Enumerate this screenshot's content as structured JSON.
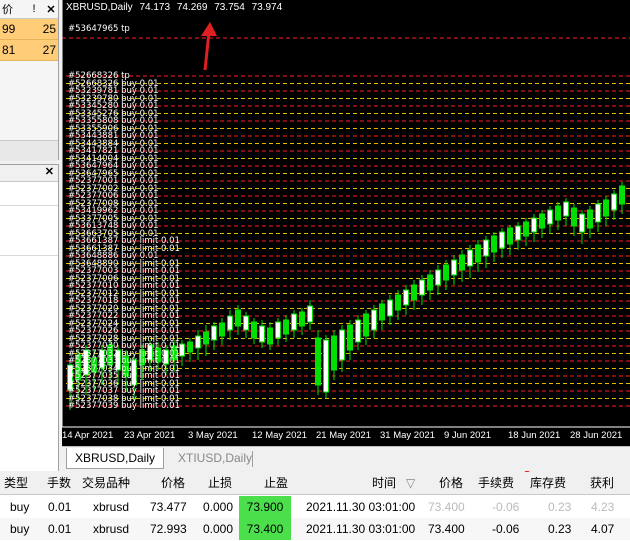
{
  "left_panel": {
    "header": {
      "col1": "价",
      "col2": "!",
      "close_icon": "close-icon"
    },
    "rows": [
      {
        "a": "99",
        "b": "25"
      },
      {
        "a": "81",
        "b": "27"
      }
    ],
    "panel2_close_icon": "close-icon"
  },
  "chart": {
    "symbol": "XBRUSD,Daily",
    "ohlc": [
      "74.173",
      "74.269",
      "73.754",
      "73.974"
    ],
    "top_label": "#53647965 tp",
    "order_labels": [
      "#52668326 tp",
      "#52668326 buy 0.01",
      "#53239781 buy 0.01",
      "#53239780 buy 0.01",
      "#53345280 buy 0.01",
      "#53345276 buy 0.01",
      "#53355808 buy 0.01",
      "#53355906 buy 0.01",
      "#53443881 buy 0.01",
      "#53443884 buy 0.01",
      "#53417821 buy 0.01",
      "#53414004 buy 0.01",
      "#53647964 buy 0.01",
      "#53647965 buy 0.01",
      "#52377001 buy 0.01",
      "#52377002 buy 0.01",
      "#52377006 buy 0.01",
      "#52377008 buy 0.01",
      "#53419962 buy 0.01",
      "#53377005 buy 0.01",
      "#53613748 buy 0.01",
      "#53663705 buy 0.01",
      "#53661387 buy limit 0.01",
      "#53661387 buy limit 0.01",
      "#53648886 buy 0.01",
      "#53648890 buy limit 0.01",
      "#52377003 buy limit 0.01",
      "#52377006 buy limit 0.01",
      "#52377010 buy limit 0.01",
      "#52377012 buy limit 0.01",
      "#52377018 buy limit 0.01",
      "#52377020 buy limit 0.01",
      "#52377022 buy limit 0.01",
      "#52377024 buy limit 0.01",
      "#52377026 buy limit 0.01",
      "#52377028 buy limit 0.01",
      "#52377030 buy limit 0.01",
      "#52377032 buy limit 0.01",
      "#52377033 buy limit 0.01",
      "#52377034 buy limit 0.01",
      "#52377035 buy limit 0.01",
      "#52377036 buy limit 0.01",
      "#52377037 buy limit 0.01",
      "#52377038 buy limit 0.01",
      "#52377039 buy limit 0.01"
    ],
    "x_labels": [
      "14 Apr 2021",
      "23 Apr 2021",
      "3 May 2021",
      "12 May 2021",
      "21 May 2021",
      "31 May 2021",
      "9 Jun 2021",
      "18 Jun 2021",
      "28 Jun 2021"
    ],
    "colors": {
      "background": "#000000",
      "up": "#00e000",
      "down": "#00e000",
      "order_red": "#ff2020",
      "order_yellow": "#e0c000",
      "body_white": "#ffffff"
    }
  },
  "tabs": [
    {
      "label": "XBRUSD,Daily",
      "active": true
    },
    {
      "label": "XTIUSD,Daily",
      "active": false
    }
  ],
  "table": {
    "headers": [
      "类型",
      "手数",
      "交易品种",
      "价格",
      "止损",
      "止盈",
      "时间",
      "价格",
      "手续费",
      "库存费",
      "获利"
    ],
    "sort_icon": "sort-down-icon",
    "rows": [
      {
        "type": "buy",
        "lots": "0.01",
        "symbol": "xbrusd",
        "price": "73.477",
        "sl": "0.000",
        "tp": "73.900",
        "time": "2021.11.30 03:01:00",
        "cur_price": "73.400",
        "commission": "-0.06",
        "swap": "0.23",
        "profit": "4.23"
      },
      {
        "type": "buy",
        "lots": "0.01",
        "symbol": "xbrusd",
        "price": "72.993",
        "sl": "0.000",
        "tp": "73.400",
        "time": "2021.11.30 03:01:00",
        "cur_price": "73.400",
        "commission": "-0.06",
        "swap": "0.23",
        "profit": "4.07"
      }
    ]
  }
}
